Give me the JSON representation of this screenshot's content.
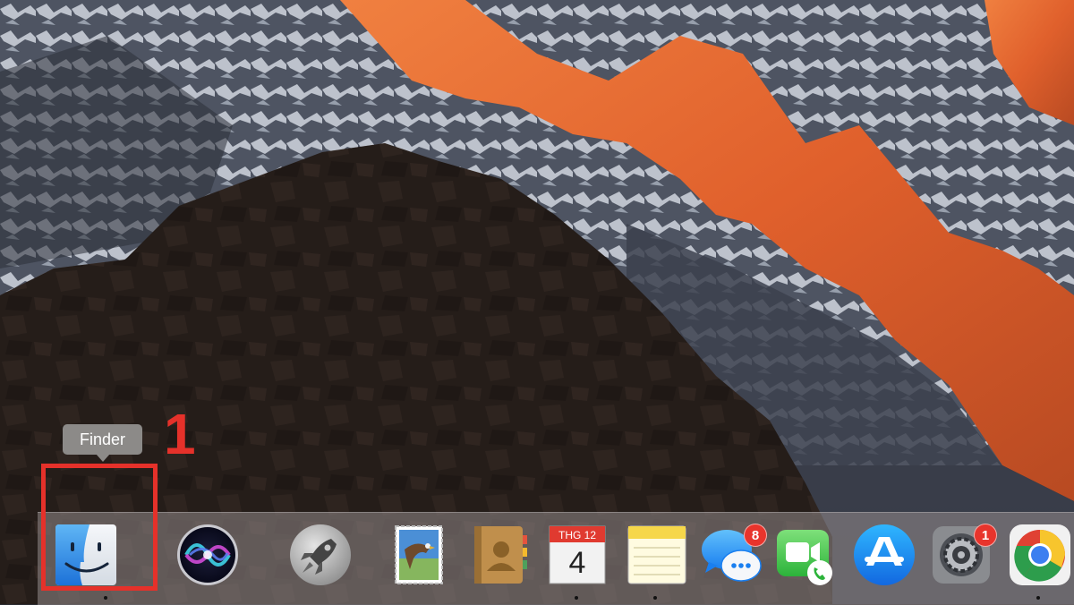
{
  "tooltip": {
    "text": "Finder"
  },
  "annotation": {
    "step_number": "1",
    "color": "#e5312a"
  },
  "calendar": {
    "month": "THG 12",
    "day": "4"
  },
  "dock": {
    "items": [
      {
        "name": "Finder",
        "icon": "finder-icon",
        "running": true
      },
      {
        "name": "Siri",
        "icon": "siri-icon",
        "running": false
      },
      {
        "name": "Launchpad",
        "icon": "launchpad-rocket-icon",
        "running": false
      },
      {
        "name": "Mail",
        "icon": "mail-stamp-icon",
        "running": false
      },
      {
        "name": "Contacts",
        "icon": "contacts-book-icon",
        "running": false
      },
      {
        "name": "Calendar",
        "icon": "calendar-icon",
        "running": true
      },
      {
        "name": "Notes",
        "icon": "notes-icon",
        "running": true
      },
      {
        "name": "Messages",
        "icon": "messages-icon",
        "badge": "8",
        "running": false
      },
      {
        "name": "FaceTime",
        "icon": "facetime-icon",
        "running": false
      },
      {
        "name": "App Store",
        "icon": "app-store-icon",
        "running": false
      },
      {
        "name": "System Preferences",
        "icon": "system-preferences-gear-icon",
        "badge": "1",
        "running": false
      },
      {
        "name": "Google Chrome",
        "icon": "chrome-icon",
        "running": true
      }
    ]
  }
}
